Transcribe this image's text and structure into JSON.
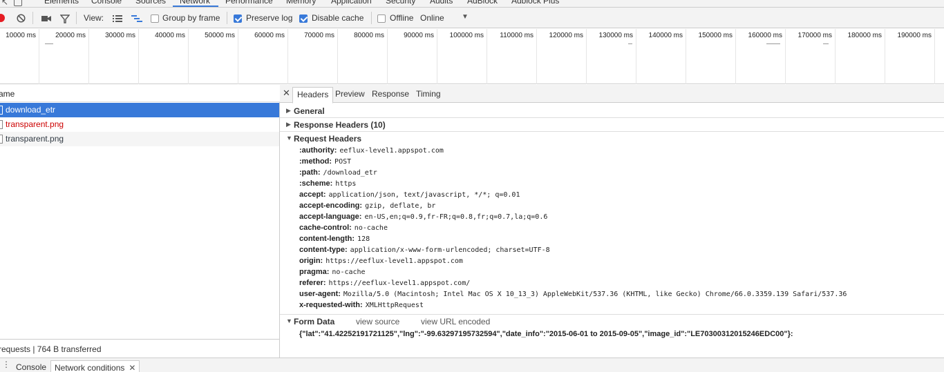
{
  "panel_tabs": [
    {
      "label": "Elements"
    },
    {
      "label": "Console"
    },
    {
      "label": "Sources"
    },
    {
      "label": "Network",
      "active": true
    },
    {
      "label": "Performance"
    },
    {
      "label": "Memory"
    },
    {
      "label": "Application"
    },
    {
      "label": "Security"
    },
    {
      "label": "Audits"
    },
    {
      "label": "AdBlock"
    },
    {
      "label": "Adblock Plus"
    }
  ],
  "toolbar": {
    "view_label": "View:",
    "group_by_frame": {
      "label": "Group by frame",
      "checked": false
    },
    "preserve_log": {
      "label": "Preserve log",
      "checked": true
    },
    "disable_cache": {
      "label": "Disable cache",
      "checked": true
    },
    "offline": {
      "label": "Offline",
      "checked": false
    },
    "throttle_value": "Online",
    "accent_color": "#3879d9",
    "record_color": "#e51c23"
  },
  "timeline": {
    "ticks": [
      "10000 ms",
      "20000 ms",
      "30000 ms",
      "40000 ms",
      "50000 ms",
      "60000 ms",
      "70000 ms",
      "80000 ms",
      "90000 ms",
      "100000 ms",
      "110000 ms",
      "120000 ms",
      "130000 ms",
      "140000 ms",
      "150000 ms",
      "160000 ms",
      "170000 ms",
      "180000 ms",
      "190000 ms"
    ]
  },
  "requests": {
    "header": "ame",
    "rows": [
      {
        "name": "download_etr",
        "state": "selected"
      },
      {
        "name": "transparent.png",
        "state": "error"
      },
      {
        "name": "transparent.png",
        "state": "normal"
      }
    ],
    "summary": "requests | 764 B transferred"
  },
  "details": {
    "tabs": [
      "Headers",
      "Preview",
      "Response",
      "Timing"
    ],
    "active_tab": "Headers",
    "sections": {
      "general": "General",
      "response_headers": "Response Headers (10)",
      "request_headers": "Request Headers",
      "form_data": "Form Data"
    },
    "request_headers": [
      {
        "name": ":authority:",
        "value": "eeflux-level1.appspot.com"
      },
      {
        "name": ":method:",
        "value": "POST"
      },
      {
        "name": ":path:",
        "value": "/download_etr"
      },
      {
        "name": ":scheme:",
        "value": "https"
      },
      {
        "name": "accept:",
        "value": "application/json, text/javascript, */*; q=0.01"
      },
      {
        "name": "accept-encoding:",
        "value": "gzip, deflate, br"
      },
      {
        "name": "accept-language:",
        "value": "en-US,en;q=0.9,fr-FR;q=0.8,fr;q=0.7,la;q=0.6"
      },
      {
        "name": "cache-control:",
        "value": "no-cache"
      },
      {
        "name": "content-length:",
        "value": "128"
      },
      {
        "name": "content-type:",
        "value": "application/x-www-form-urlencoded; charset=UTF-8"
      },
      {
        "name": "origin:",
        "value": "https://eeflux-level1.appspot.com"
      },
      {
        "name": "pragma:",
        "value": "no-cache"
      },
      {
        "name": "referer:",
        "value": "https://eeflux-level1.appspot.com/"
      },
      {
        "name": "user-agent:",
        "value": "Mozilla/5.0 (Macintosh; Intel Mac OS X 10_13_3) AppleWebKit/537.36 (KHTML, like Gecko) Chrome/66.0.3359.139 Safari/537.36"
      },
      {
        "name": "x-requested-with:",
        "value": "XMLHttpRequest"
      }
    ],
    "form_data_links": {
      "view_source": "view source",
      "view_url_encoded": "view URL encoded"
    },
    "form_data_body": "{\"lat\":\"41.42252191721125\",\"lng\":\"-99.63297195732594\",\"date_info\":\"2015-06-01 to 2015-09-05\",\"image_id\":\"LE70300312015246EDC00\"}:"
  },
  "drawer": {
    "tabs": [
      "Console",
      "Network conditions"
    ]
  }
}
